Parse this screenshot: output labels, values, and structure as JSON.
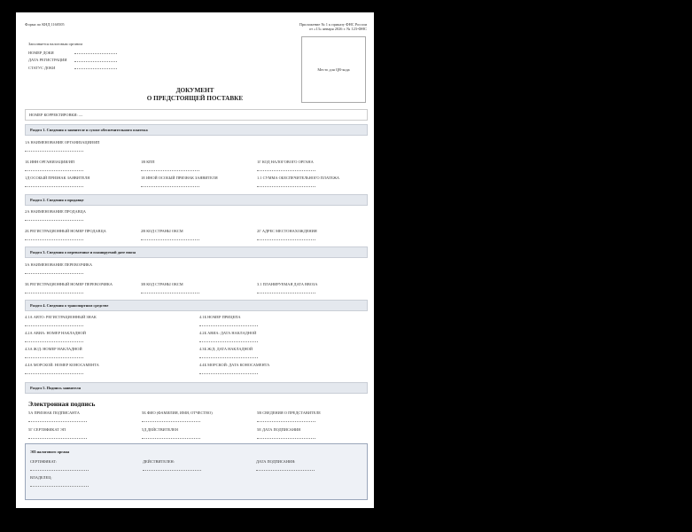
{
  "header": {
    "form_code": "Форма по КНД 1160505",
    "appendix_line1": "Приложение № 1 к приказу ФНС России",
    "appendix_line2": "от «13» января 2026 г. № 123-ФНС"
  },
  "registration": {
    "title": "Заполняется налоговым органом",
    "rows": [
      "НОМЕР ДОКИ",
      "ДАТА РЕГИСТРАЦИИ",
      "СТАТУС ДОКИ"
    ]
  },
  "qr_placeholder": "Место для QR-кода",
  "doc_title_line1": "ДОКУМЕНТ",
  "doc_title_line2": "О ПРЕДСТОЯЩЕЙ ПОСТАВКЕ",
  "correction_label": "НОМЕР КОРРЕКТИРОВКИ: —",
  "section1": {
    "title": "Раздел 1. Сведения о заявителе и сумме обеспечительного платежа",
    "f_name": "1А НАИМЕНОВАНИЕ ОРГАНИЗАЦИИ/ИП",
    "f_inn": "1Б ИНН ОРГАНИЗАЦИИ/ИП",
    "f_kpp": "1В КПП",
    "f_tax": "1Г КОД НАЛОГОВОГО ОРГАНА",
    "f_special": "1Д ОСОБЫЙ ПРИЗНАК ЗАЯВИТЕЛЯ",
    "f_other_special": "1Е ИНОЙ ОСОБЫЙ ПРИЗНАК ЗАЯВИТЕЛЯ",
    "f_sum": "1.1 СУММА ОБЕСПЕЧИТЕЛЬНОГО ПЛАТЕЖА"
  },
  "section2": {
    "title": "Раздел 2. Сведения о продавце",
    "f_name": "2А НАИМЕНОВАНИЕ ПРОДАВЦА",
    "f_reg": "2Б РЕГИСТРАЦИОННЫЙ НОМЕР ПРОДАВЦА",
    "f_country": "2В КОД СТРАНЫ ОКСМ",
    "f_address": "2Г АДРЕС МЕСТОНАХОЖДЕНИЯ"
  },
  "section3": {
    "title": "Раздел 3. Сведения о перевозчике и планируемой дате ввоза",
    "f_name": "3А НАИМЕНОВАНИЕ ПЕРЕВОЗЧИКА",
    "f_reg": "3Б РЕГИСТРАЦИОННЫЙ НОМЕР ПЕРЕВОЗЧИКА",
    "f_country": "3В КОД СТРАНЫ ОКСМ",
    "f_date": "3.1 ПЛАНИРУЕМАЯ ДАТА ВВОЗА"
  },
  "section4": {
    "title": "Раздел 4. Сведения о транспортном средстве",
    "f_auto": "4.1А АВТО: РЕГИСТРАЦИОННЫЙ ЗНАК",
    "f_trailer": "4.1Б НОМЕР ПРИЦЕПА",
    "f_avia_num": "4.2А АВИА: НОМЕР НАКЛАДНОЙ",
    "f_avia_date": "4.2Б АВИА: ДАТА НАКЛАДНОЙ",
    "f_rail_num": "4.3А Ж/Д: НОМЕР НАКЛАДНОЙ",
    "f_rail_date": "4.3Б Ж/Д: ДАТА НАКЛАДНОЙ",
    "f_sea_num": "4.4А МОРСКОЙ: НОМЕР КОНОСАМЕНТА",
    "f_sea_date": "4.4Б МОРСКОЙ: ДАТА КОНОСАМЕНТА"
  },
  "section5": {
    "title": "Раздел 5. Подпись заявителя",
    "es_title": "Электронная подпись",
    "f_sign_attr": "5А ПРИЗНАК ПОДПИСАНТА",
    "f_fio": "5Б ФИО (ФАМИЛИЯ, ИМЯ, ОТЧЕСТВО)",
    "f_rep": "5В СВЕДЕНИЯ О ПРЕДСТАВИТЕЛЕ",
    "f_cert": "5Г СЕРТИФИКАТ ЭП",
    "f_valid": "5Д ДЕЙСТВИТЕЛЕН",
    "f_sign_date": "5Е ДАТА ПОДПИСАНИЯ"
  },
  "tax_es": {
    "title": "ЭП налогового органа",
    "cert": "СЕРТИФИКАТ:",
    "valid": "ДЕЙСТВИТЕЛЕН:",
    "date": "ДАТА ПОДПИСАНИЯ:",
    "owner": "ВЛАДЕЛЕЦ:"
  }
}
